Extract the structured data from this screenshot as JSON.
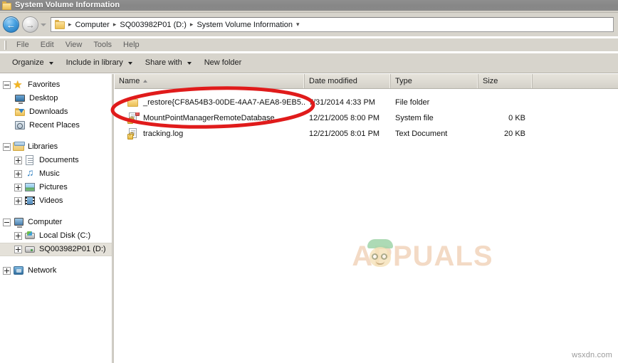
{
  "titlebar": {
    "title": "System Volume Information",
    "icon": "folder-icon"
  },
  "navigation": {
    "back_label": "←",
    "forward_label": "→",
    "recent_pages_label": "▾"
  },
  "address_bar": {
    "folder_icon": "folder-icon",
    "separator": "▸",
    "crumbs": [
      "Computer",
      "SQ003982P01 (D:)",
      "System Volume Information"
    ],
    "trailing_caret": "▾"
  },
  "menubar": {
    "items": [
      "File",
      "Edit",
      "View",
      "Tools",
      "Help"
    ]
  },
  "toolbar": {
    "items": [
      {
        "label": "Organize",
        "has_caret": true
      },
      {
        "label": "Include in library",
        "has_caret": true
      },
      {
        "label": "Share with",
        "has_caret": true
      },
      {
        "label": "New folder",
        "has_caret": false
      }
    ]
  },
  "sidebar": {
    "groups": [
      {
        "header": {
          "label": "Favorites",
          "icon": "star-icon",
          "expander": "minus"
        },
        "items": [
          {
            "label": "Desktop",
            "icon": "desktop-icon",
            "expander": "none"
          },
          {
            "label": "Downloads",
            "icon": "downloads-icon",
            "expander": "none"
          },
          {
            "label": "Recent Places",
            "icon": "recent-places-icon",
            "expander": "none"
          }
        ]
      },
      {
        "header": {
          "label": "Libraries",
          "icon": "libraries-icon",
          "expander": "minus"
        },
        "items": [
          {
            "label": "Documents",
            "icon": "documents-icon",
            "expander": "plus"
          },
          {
            "label": "Music",
            "icon": "music-icon",
            "expander": "plus"
          },
          {
            "label": "Pictures",
            "icon": "pictures-icon",
            "expander": "plus"
          },
          {
            "label": "Videos",
            "icon": "videos-icon",
            "expander": "plus"
          }
        ]
      },
      {
        "header": {
          "label": "Computer",
          "icon": "computer-icon",
          "expander": "minus"
        },
        "items": [
          {
            "label": "Local Disk (C:)",
            "icon": "hard-disk-icon",
            "expander": "plus",
            "selected": false
          },
          {
            "label": "SQ003982P01 (D:)",
            "icon": "drive-icon",
            "expander": "plus",
            "selected": true
          }
        ]
      },
      {
        "header": {
          "label": "Network",
          "icon": "network-icon",
          "expander": "plus"
        },
        "items": []
      }
    ]
  },
  "file_list": {
    "columns": [
      {
        "label": "Name",
        "sorted": true,
        "sort_direction": "ascending"
      },
      {
        "label": "Date modified",
        "sorted": false
      },
      {
        "label": "Type",
        "sorted": false
      },
      {
        "label": "Size",
        "sorted": false
      }
    ],
    "rows": [
      {
        "name": "_restore{CF8A54B3-00DE-4AA7-AEA8-9EB5...",
        "date_modified": "7/31/2014 4:33 PM",
        "type": "File folder",
        "size": "",
        "icon": "folder-icon"
      },
      {
        "name": "MountPointManagerRemoteDatabase",
        "date_modified": "12/21/2005 8:00 PM",
        "type": "System file",
        "size": "0 KB",
        "icon": "locked-system-file-icon"
      },
      {
        "name": "tracking.log",
        "date_modified": "12/21/2005 8:01 PM",
        "type": "Text Document",
        "size": "20 KB",
        "icon": "locked-text-file-icon"
      }
    ]
  },
  "watermark": {
    "text": "APPUALS"
  },
  "annotation": {
    "shape": "ellipse",
    "color": "#e01b1b",
    "target": "_restore folder row"
  },
  "credit": {
    "text": "wsxdn.com"
  },
  "colors": {
    "titlebar": "#8a8a8a",
    "chrome": "#d7d4cc",
    "pane_background": "#ffffff",
    "selection": "#e4e1d9",
    "annotation_red": "#e01b1b",
    "watermark": "#f3d9c2"
  }
}
